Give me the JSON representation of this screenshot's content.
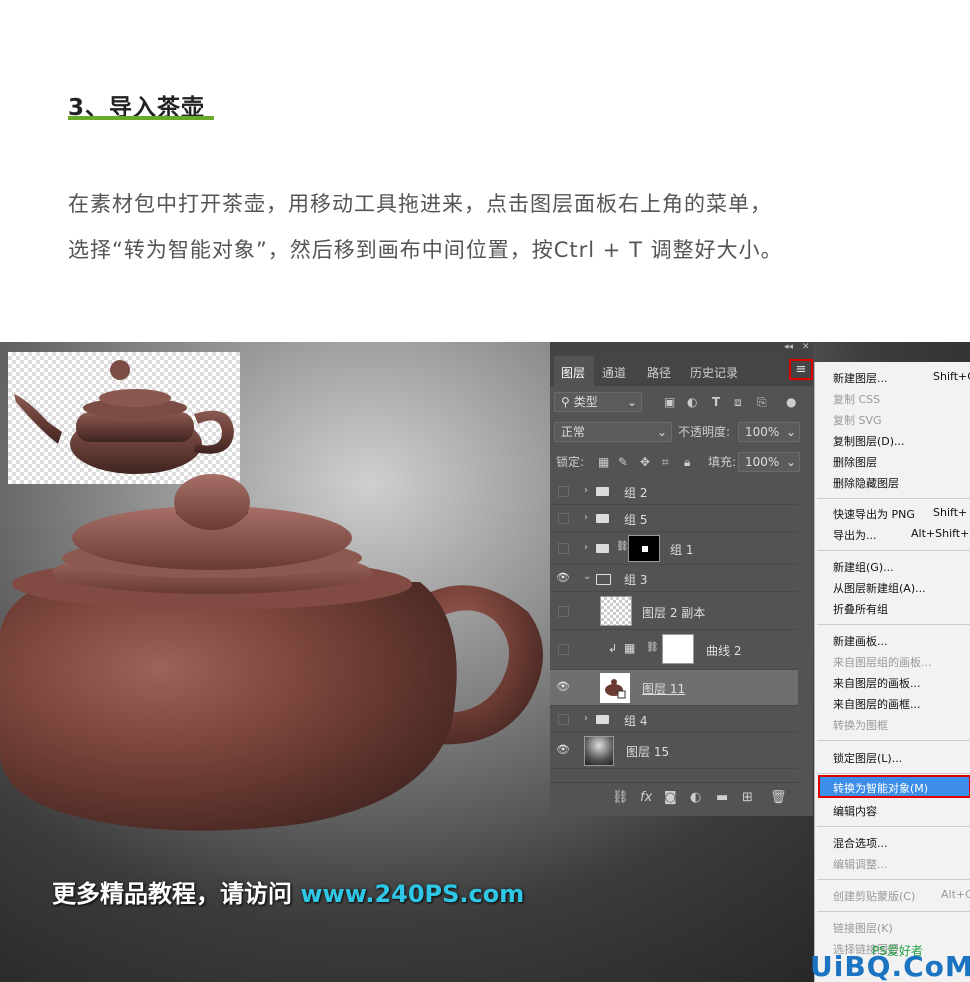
{
  "article": {
    "heading": "3、导入茶壶",
    "para_line1": "在素材包中打开茶壶，用移动工具拖进来，点击图层面板右上角的菜单，",
    "para_line2": "选择“转为智能对象”，然后移到画布中间位置，按Ctrl + T 调整好大小。"
  },
  "canvas": {
    "watermark_text": "更多精品教程，请访问 ",
    "watermark_url": "www.240PS.com"
  },
  "layers_panel": {
    "tabs": [
      "图层",
      "通道",
      "路径",
      "历史记录"
    ],
    "filter_label": "类型",
    "filter_icons": [
      "image-filter-icon",
      "adjustment-filter-icon",
      "text-filter-icon",
      "shape-filter-icon",
      "smart-object-filter-icon"
    ],
    "blend_mode": "正常",
    "opacity_label": "不透明度:",
    "opacity_value": "100%",
    "lock_label": "锁定:",
    "fill_label": "填充:",
    "fill_value": "100%",
    "layers": [
      {
        "name": "组 2",
        "type": "group",
        "visible": false
      },
      {
        "name": "组 5",
        "type": "group",
        "visible": false
      },
      {
        "name": "组 1",
        "type": "group-mask",
        "visible": false
      },
      {
        "name": "组 3",
        "type": "group-open",
        "visible": true
      },
      {
        "name": "图层 2 副本",
        "type": "layer",
        "visible": false
      },
      {
        "name": "曲线 2",
        "type": "adjustment",
        "visible": false
      },
      {
        "name": "图层 11",
        "type": "layer",
        "visible": true,
        "selected": true
      },
      {
        "name": "组 4",
        "type": "group",
        "visible": false
      },
      {
        "name": "图层 15",
        "type": "layer",
        "visible": true
      }
    ],
    "footer_icons": [
      "link-icon",
      "fx-icon",
      "mask-icon",
      "adjustment-icon",
      "new-group-icon",
      "new-layer-icon",
      "delete-icon"
    ],
    "footer_fx": "fx"
  },
  "context_menu": {
    "items": [
      {
        "label": "新建图层...",
        "shortcut": "Shift+C",
        "disabled": false
      },
      {
        "label": "复制 CSS",
        "shortcut": "",
        "disabled": true
      },
      {
        "label": "复制 SVG",
        "shortcut": "",
        "disabled": true
      },
      {
        "label": "复制图层(D)...",
        "shortcut": "",
        "disabled": false
      },
      {
        "label": "删除图层",
        "shortcut": "",
        "disabled": false
      },
      {
        "label": "删除隐藏图层",
        "shortcut": "",
        "disabled": false
      },
      {
        "label": "快速导出为 PNG",
        "shortcut": "Shift+",
        "disabled": false
      },
      {
        "label": "导出为...",
        "shortcut": "Alt+Shift+",
        "disabled": false
      },
      {
        "label": "新建组(G)...",
        "shortcut": "",
        "disabled": false
      },
      {
        "label": "从图层新建组(A)...",
        "shortcut": "",
        "disabled": false
      },
      {
        "label": "折叠所有组",
        "shortcut": "",
        "disabled": false
      },
      {
        "label": "新建画板...",
        "shortcut": "",
        "disabled": false
      },
      {
        "label": "来自图层组的画板...",
        "shortcut": "",
        "disabled": true
      },
      {
        "label": "来自图层的画板...",
        "shortcut": "",
        "disabled": false
      },
      {
        "label": "来自图层的画框...",
        "shortcut": "",
        "disabled": false
      },
      {
        "label": "转换为图框",
        "shortcut": "",
        "disabled": true
      },
      {
        "label": "锁定图层(L)...",
        "shortcut": "",
        "disabled": false
      },
      {
        "label": "转换为智能对象(M)",
        "shortcut": "",
        "disabled": false,
        "highlighted": true
      },
      {
        "label": "编辑内容",
        "shortcut": "",
        "disabled": false
      },
      {
        "label": "混合选项...",
        "shortcut": "",
        "disabled": false
      },
      {
        "label": "编辑调整...",
        "shortcut": "",
        "disabled": true
      },
      {
        "label": "创建剪贴蒙版(C)",
        "shortcut": "Alt+C",
        "disabled": true
      },
      {
        "label": "链接图层(K)",
        "shortcut": "",
        "disabled": true
      },
      {
        "label": "选择链接图层",
        "shortcut": "",
        "disabled": true
      }
    ]
  },
  "logo": {
    "text": "UiBQ.CoM",
    "sub": "PS爱好者"
  },
  "colors": {
    "accent_underline": "#6aaa2a",
    "highlight": "#3d8ee8",
    "annotation_red": "#dd0000",
    "watermark_url": "#2ec7e6"
  }
}
